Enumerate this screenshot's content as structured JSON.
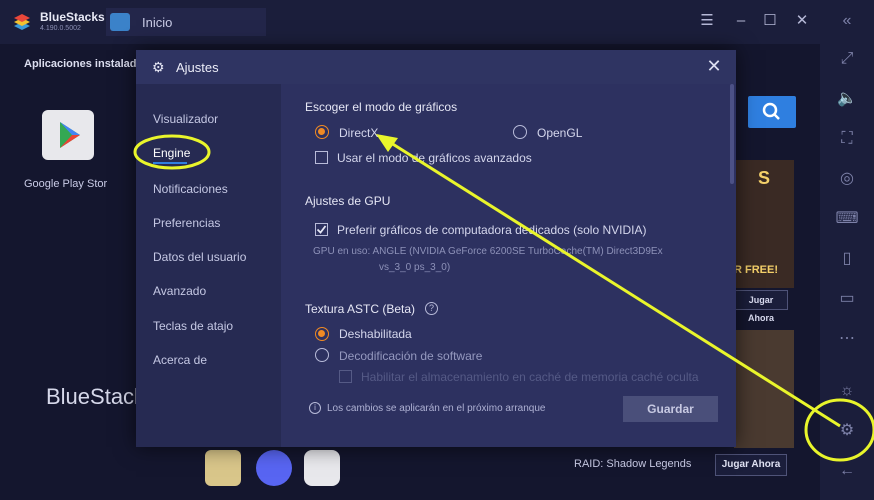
{
  "app": {
    "brand": "BlueStacks",
    "version": "4.190.0.5002",
    "home_tab": "Inicio",
    "section_title": "Aplicaciones instaladas",
    "google_play_label": "Google Play Stor",
    "watermark": "BlueStacks",
    "raid_label": "RAID: Shadow Legends",
    "play_now": "Jugar Ahora",
    "promo_text": "S",
    "free_text": "R FREE!"
  },
  "dialog": {
    "title": "Ajustes",
    "nav": [
      "Visualizador",
      "Engine",
      "Notificaciones",
      "Preferencias",
      "Datos del usuario",
      "Avanzado",
      "Teclas de atajo",
      "Acerca de"
    ],
    "graphics_heading": "Escoger el modo de gráficos",
    "opt_directx": "DirectX",
    "opt_opengl": "OpenGL",
    "opt_advanced": "Usar el modo de gráficos avanzados",
    "gpu_heading": "Ajustes de GPU",
    "opt_dedicated": "Preferir gráficos de computadora dedicados (solo NVIDIA)",
    "gpu_in_use_line1": "GPU en uso:  ANGLE (NVIDIA GeForce 6200SE TurboCache(TM) Direct3D9Ex",
    "gpu_in_use_line2": "vs_3_0 ps_3_0)",
    "astc_heading": "Textura ASTC (Beta)",
    "opt_disabled": "Deshabilitada",
    "opt_software": "Decodificación de software",
    "opt_cache": "Habilitar el almacenamiento en caché de memoria caché oculta",
    "footer_note": "Los cambios se aplicarán en el próximo arranque",
    "save_label": "Guardar"
  },
  "colors": {
    "accent": "#2f7fe0",
    "radio_on": "#f08a24",
    "annotation": "#e9f52b"
  }
}
